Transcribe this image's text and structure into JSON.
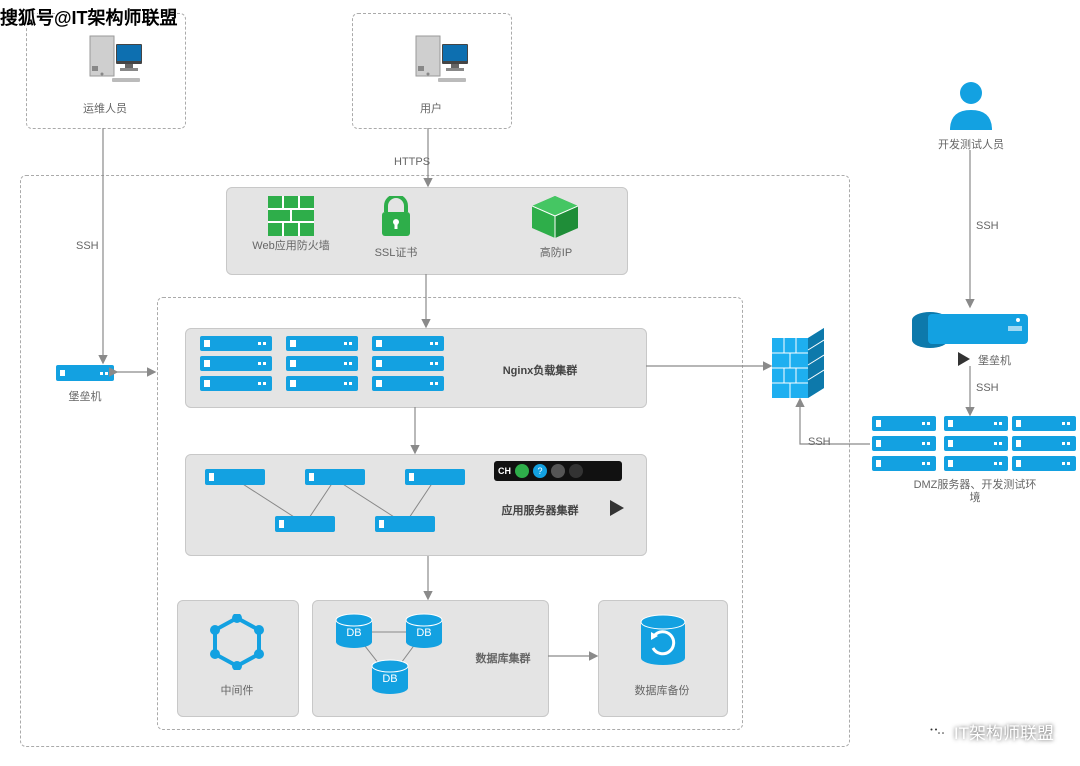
{
  "watermark_top_left": "搜狐号@IT架构师联盟",
  "watermark_bottom_right": "IT架构师联盟",
  "nodes": {
    "ops_staff": "运维人员",
    "user": "用户",
    "dev_test_staff": "开发测试人员",
    "bastion_left": "堡垒机",
    "bastion_right": "堡垒机",
    "waf": "Web应用防火墙",
    "ssl": "SSL证书",
    "anti_ddos": "高防IP",
    "nginx_cluster": "Nginx负载集群",
    "app_cluster": "应用服务器集群",
    "middleware": "中间件",
    "db_cluster": "数据库集群",
    "db_backup": "数据库备份",
    "dmz_env": "DMZ服务器、开发测试环境",
    "db_text": "DB",
    "icon_bar_text": "CH"
  },
  "edges": {
    "https": "HTTPS",
    "ssh": "SSH"
  },
  "colors": {
    "c_blue": "#13a1e1",
    "c_green": "#2eae4a",
    "c_grey": "#8a8a8a"
  }
}
